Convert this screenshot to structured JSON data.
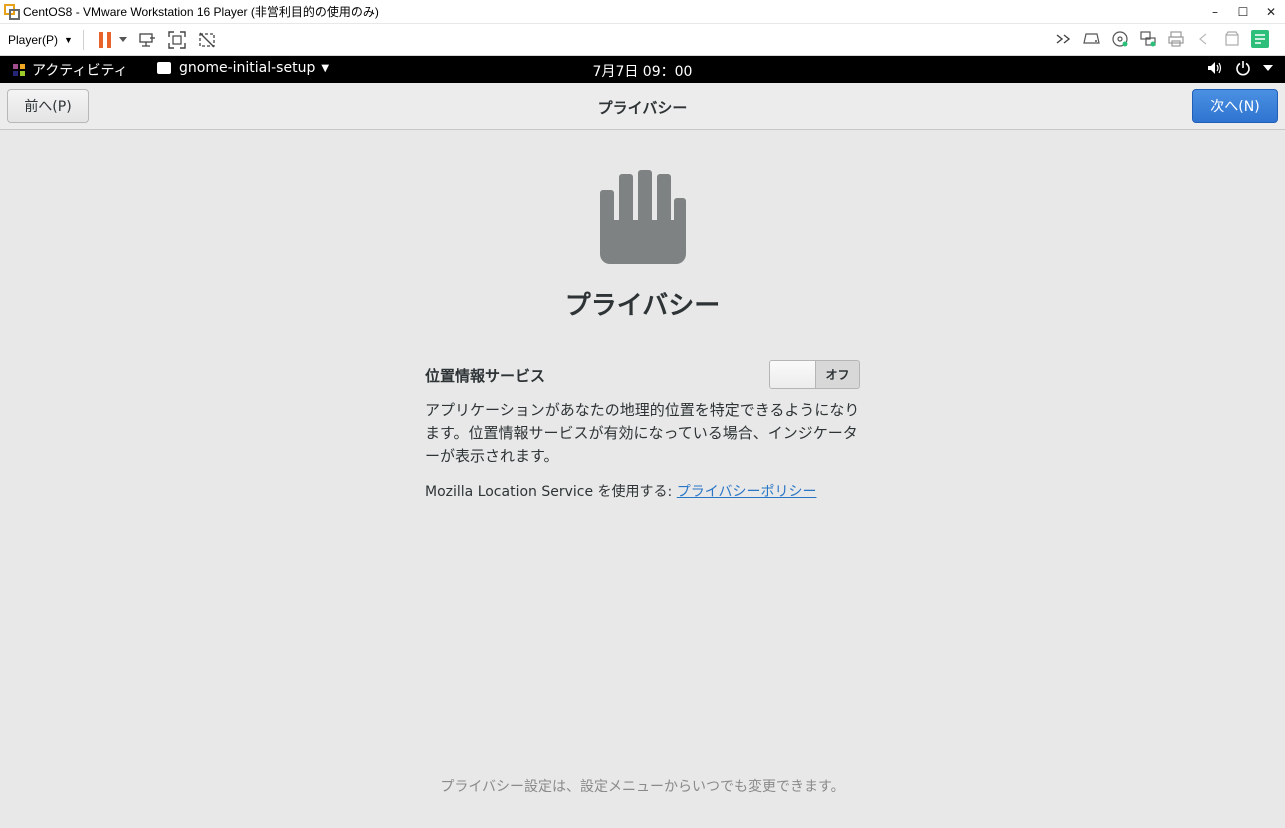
{
  "window": {
    "title": "CentOS8 - VMware Workstation 16 Player (非営利目的の使用のみ)",
    "controls": {
      "minimize": "–",
      "maximize": "☐",
      "close": "✕"
    }
  },
  "vm_toolbar": {
    "player_menu": "Player(P)",
    "left_icons": [
      "pause-icon",
      "pause-dropdown-icon",
      "send-ctrl-alt-del-icon",
      "fullscreen-icon",
      "unity-icon"
    ],
    "right_icons": [
      "more-icon",
      "hard-disk-icon",
      "cd-dvd-icon",
      "network-icon",
      "printer-icon",
      "usb-icon",
      "sound-card-icon",
      "message-log-icon"
    ],
    "pause_color": "#e8622a",
    "message_icon_color": "#2dbf7a"
  },
  "gnome_topbar": {
    "activities": "アクティビティ",
    "app_menu": "gnome-initial-setup",
    "clock": "7月7日 09：00"
  },
  "header": {
    "prev_button": "前へ(P)",
    "title": "プライバシー",
    "next_button": "次へ(N)",
    "next_button_color": "#3584e4"
  },
  "content": {
    "icon": "hand-icon",
    "title": "プライバシー",
    "location_services_label": "位置情報サービス",
    "toggle_state": "オフ",
    "toggle_on": false,
    "description": "アプリケーションがあなたの地理的位置を特定できるようになります。位置情報サービスが有効になっている場合、インジケーターが表示されます。",
    "mls_prefix": "Mozilla Location Service を使用する: ",
    "mls_link": "プライバシーポリシー",
    "footer_note": "プライバシー設定は、設定メニューからいつでも変更できます。"
  }
}
